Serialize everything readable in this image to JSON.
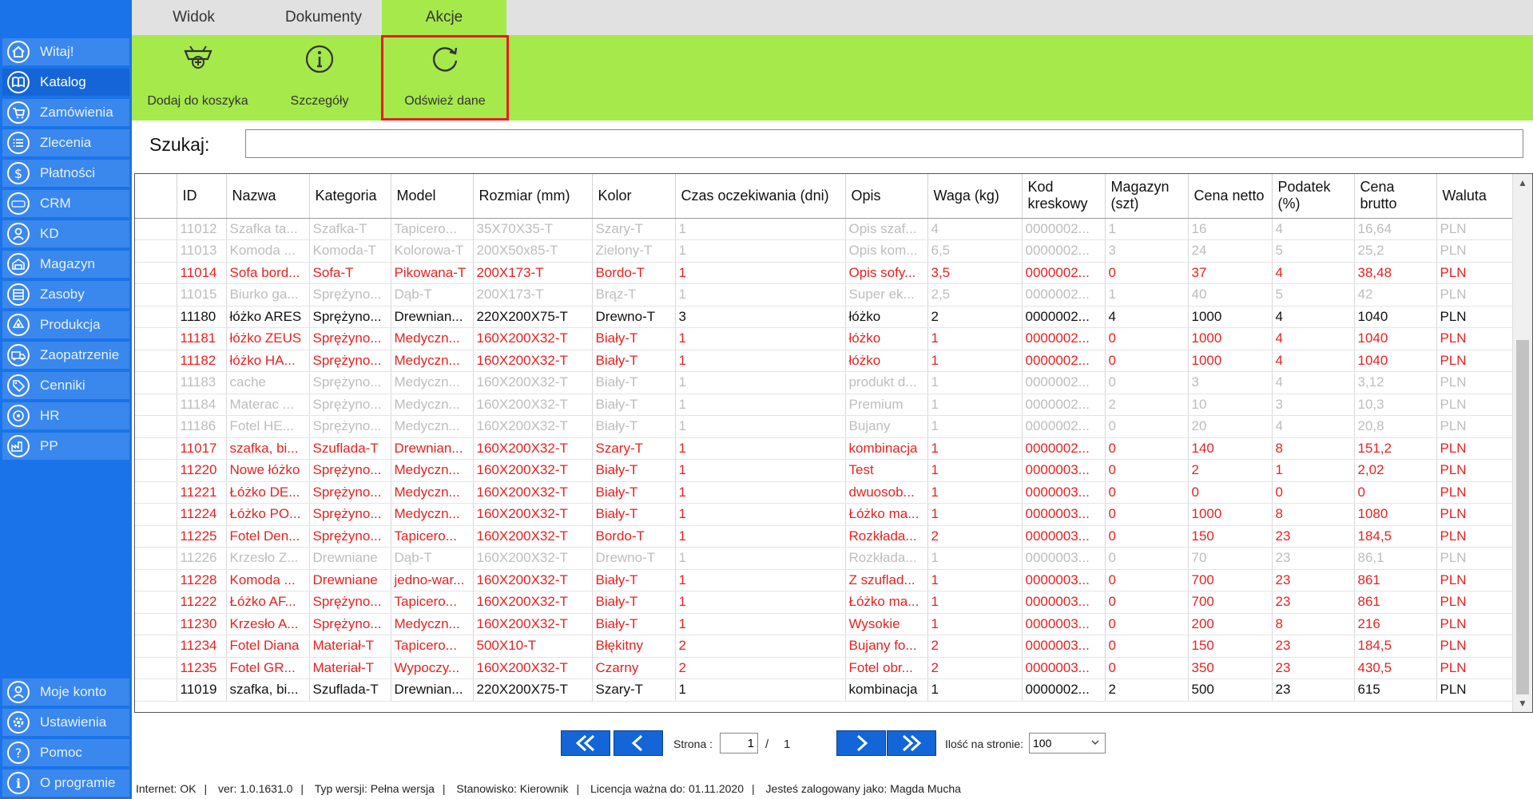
{
  "sidebar": {
    "items": [
      {
        "label": "Witaj!",
        "icon": "home-icon"
      },
      {
        "label": "Katalog",
        "icon": "book-icon",
        "active": true
      },
      {
        "label": "Zamówienia",
        "icon": "cart-icon"
      },
      {
        "label": "Zlecenia",
        "icon": "list-icon"
      },
      {
        "label": "Płatności",
        "icon": "dollar-icon"
      },
      {
        "label": "CRM",
        "icon": "crm-icon"
      },
      {
        "label": "KD",
        "icon": "user-icon"
      },
      {
        "label": "Magazyn",
        "icon": "warehouse-icon"
      },
      {
        "label": "Zasoby",
        "icon": "resources-icon"
      },
      {
        "label": "Produkcja",
        "icon": "production-icon"
      },
      {
        "label": "Zaopatrzenie",
        "icon": "truck-icon"
      },
      {
        "label": "Cenniki",
        "icon": "tag-icon"
      },
      {
        "label": "HR",
        "icon": "hr-icon"
      },
      {
        "label": "PP",
        "icon": "factory-icon"
      }
    ],
    "bottom_items": [
      {
        "label": "Moje konto",
        "icon": "account-icon"
      },
      {
        "label": "Ustawienia",
        "icon": "settings-icon"
      },
      {
        "label": "Pomoc",
        "icon": "help-icon"
      },
      {
        "label": "O programie",
        "icon": "info-icon"
      }
    ]
  },
  "tabs": [
    {
      "label": "Widok"
    },
    {
      "label": "Dokumenty"
    },
    {
      "label": "Akcje",
      "active": true
    }
  ],
  "ribbon": {
    "buttons": [
      {
        "label": "Dodaj do koszyka",
        "icon": "add-to-cart-icon"
      },
      {
        "label": "Szczegóły",
        "icon": "info-circle-icon"
      },
      {
        "label": "Odśwież dane",
        "icon": "refresh-icon",
        "highlighted": true
      }
    ]
  },
  "search": {
    "label": "Szukaj:",
    "value": ""
  },
  "table": {
    "columns": [
      "",
      "ID",
      "Nazwa",
      "Kategoria",
      "Model",
      "Rozmiar (mm)",
      "Kolor",
      "Czas oczekiwania (dni)",
      "Opis",
      "Waga (kg)",
      "Kod kreskowy",
      "Magazyn (szt)",
      "Cena netto",
      "Podatek (%)",
      "Cena brutto",
      "Waluta"
    ],
    "rows": [
      {
        "state": "disabled",
        "cells": [
          "",
          "11012",
          "Szafka ta...",
          "Szafka-T",
          "Tapicero...",
          "35X70X35-T",
          "Szary-T",
          "1",
          "Opis szaf...",
          "4",
          "0000002...",
          "1",
          "16",
          "4",
          "16,64",
          "PLN"
        ]
      },
      {
        "state": "disabled",
        "cells": [
          "",
          "11013",
          "Komoda ...",
          "Komoda-T",
          "Kolorowa-T",
          "200X50x85-T",
          "Zielony-T",
          "1",
          "Opis kom...",
          "6,5",
          "0000002...",
          "3",
          "24",
          "5",
          "25,2",
          "PLN"
        ]
      },
      {
        "state": "error",
        "cells": [
          "",
          "11014",
          "Sofa bord...",
          "Sofa-T",
          "Pikowana-T",
          "200X173-T",
          "Bordo-T",
          "1",
          "Opis sofy...",
          "3,5",
          "0000002...",
          "0",
          "37",
          "4",
          "38,48",
          "PLN"
        ]
      },
      {
        "state": "disabled",
        "cells": [
          "",
          "11015",
          "Biurko ga...",
          "Sprężyno...",
          "Dąb-T",
          "200X173-T",
          "Brąz-T",
          "1",
          "Super ek...",
          "2,5",
          "0000002...",
          "1",
          "40",
          "5",
          "42",
          "PLN"
        ]
      },
      {
        "state": "normal",
        "cells": [
          "",
          "11180",
          "łóżko ARES",
          "Sprężyno...",
          "Drewnian...",
          "220X200X75-T",
          "Drewno-T",
          "3",
          "łóżko",
          "2",
          "0000002...",
          "4",
          "1000",
          "4",
          "1040",
          "PLN"
        ]
      },
      {
        "state": "error",
        "cells": [
          "",
          "11181",
          "łóżko ZEUS",
          "Sprężyno...",
          "Medyczn...",
          "160X200X32-T",
          "Biały-T",
          "1",
          "łóżko",
          "1",
          "0000002...",
          "0",
          "1000",
          "4",
          "1040",
          "PLN"
        ]
      },
      {
        "state": "error",
        "cells": [
          "",
          "11182",
          "łóżko HA...",
          "Sprężyno...",
          "Medyczn...",
          "160X200X32-T",
          "Biały-T",
          "1",
          "łóżko",
          "1",
          "0000002...",
          "0",
          "1000",
          "4",
          "1040",
          "PLN"
        ]
      },
      {
        "state": "disabled",
        "cells": [
          "",
          "11183",
          "cache",
          "Sprężyno...",
          "Medyczn...",
          "160X200X32-T",
          "Biały-T",
          "1",
          "produkt d...",
          "1",
          "0000002...",
          "0",
          "3",
          "4",
          "3,12",
          "PLN"
        ]
      },
      {
        "state": "disabled",
        "cells": [
          "",
          "11184",
          "Materac ...",
          "Sprężyno...",
          "Medyczn...",
          "160X200X32-T",
          "Biały-T",
          "1",
          "Premium",
          "1",
          "0000002...",
          "2",
          "10",
          "3",
          "10,3",
          "PLN"
        ]
      },
      {
        "state": "disabled",
        "cells": [
          "",
          "11186",
          "Fotel HE...",
          "Sprężyno...",
          "Medyczn...",
          "160X200X32-T",
          "Biały-T",
          "1",
          "Bujany",
          "1",
          "0000002...",
          "0",
          "20",
          "4",
          "20,8",
          "PLN"
        ]
      },
      {
        "state": "error",
        "cells": [
          "",
          "11017",
          "szafka, bi...",
          "Szuflada-T",
          "Drewnian...",
          "160X200X32-T",
          "Szary-T",
          "1",
          "kombinacja",
          "1",
          "0000002...",
          "0",
          "140",
          "8",
          "151,2",
          "PLN"
        ]
      },
      {
        "state": "error",
        "cells": [
          "",
          "11220",
          "Nowe łóżko",
          "Sprężyno...",
          "Medyczn...",
          "160X200X32-T",
          "Biały-T",
          "1",
          "Test",
          "1",
          "0000003...",
          "0",
          "2",
          "1",
          "2,02",
          "PLN"
        ]
      },
      {
        "state": "error",
        "cells": [
          "",
          "11221",
          "Łóżko DE...",
          "Sprężyno...",
          "Medyczn...",
          "160X200X32-T",
          "Biały-T",
          "1",
          "dwuosob...",
          "1",
          "0000003...",
          "0",
          "0",
          "0",
          "0",
          "PLN"
        ]
      },
      {
        "state": "error",
        "cells": [
          "",
          "11224",
          "Łóżko PO...",
          "Sprężyno...",
          "Medyczn...",
          "160X200X32-T",
          "Biały-T",
          "1",
          "Łóżko ma...",
          "1",
          "0000003...",
          "0",
          "1000",
          "8",
          "1080",
          "PLN"
        ]
      },
      {
        "state": "error",
        "cells": [
          "",
          "11225",
          "Fotel Den...",
          "Sprężyno...",
          "Tapicero...",
          "160X200X32-T",
          "Bordo-T",
          "1",
          "Rozkłada...",
          "2",
          "0000003...",
          "0",
          "150",
          "23",
          "184,5",
          "PLN"
        ]
      },
      {
        "state": "disabled",
        "cells": [
          "",
          "11226",
          "Krzesło Z...",
          "Drewniane",
          "Dąb-T",
          "160X200X32-T",
          "Drewno-T",
          "1",
          "Rozkłada...",
          "1",
          "0000003...",
          "0",
          "70",
          "23",
          "86,1",
          "PLN"
        ]
      },
      {
        "state": "error",
        "cells": [
          "",
          "11228",
          "Komoda ...",
          "Drewniane",
          "jedno-war...",
          "160X200X32-T",
          "Biały-T",
          "1",
          "Z szuflad...",
          "1",
          "0000003...",
          "0",
          "700",
          "23",
          "861",
          "PLN"
        ]
      },
      {
        "state": "error",
        "cells": [
          "",
          "11222",
          "Łóżko AF...",
          "Sprężyno...",
          "Tapicero...",
          "160X200X32-T",
          "Biały-T",
          "1",
          "Łóżko ma...",
          "1",
          "0000003...",
          "0",
          "700",
          "23",
          "861",
          "PLN"
        ]
      },
      {
        "state": "error",
        "cells": [
          "",
          "11230",
          "Krzesło A...",
          "Sprężyno...",
          "Medyczn...",
          "160X200X32-T",
          "Biały-T",
          "1",
          "Wysokie",
          "1",
          "0000003...",
          "0",
          "200",
          "8",
          "216",
          "PLN"
        ]
      },
      {
        "state": "error",
        "cells": [
          "",
          "11234",
          "Fotel Diana",
          "Materiał-T",
          "Tapicero...",
          "500X10-T",
          "Błękitny",
          "2",
          "Bujany fo...",
          "2",
          "0000003...",
          "0",
          "150",
          "23",
          "184,5",
          "PLN"
        ]
      },
      {
        "state": "error",
        "cells": [
          "",
          "11235",
          "Fotel GR...",
          "Materiał-T",
          "Wypoczy...",
          "160X200X32-T",
          "Czarny",
          "2",
          "Fotel obr...",
          "2",
          "0000003...",
          "0",
          "350",
          "23",
          "430,5",
          "PLN"
        ]
      },
      {
        "state": "normal",
        "cells": [
          "",
          "11019",
          "szafka, bi...",
          "Szuflada-T",
          "Drewnian...",
          "220X200X75-T",
          "Szary-T",
          "1",
          "kombinacja",
          "1",
          "0000002...",
          "2",
          "500",
          "23",
          "615",
          "PLN"
        ]
      }
    ]
  },
  "pagination": {
    "page_label": "Strona :",
    "current_page": "1",
    "separator": "/",
    "total_pages": "1",
    "per_page_label": "Ilość na stronie:",
    "per_page_value": "100"
  },
  "status": {
    "internet": "Internet: OK",
    "version": "ver: 1.0.1631.0",
    "edition": "Typ wersji: Pełna wersja",
    "station": "Stanowisko: Kierownik",
    "license": "Licencja ważna do: 01.11.2020",
    "user": "Jesteś zalogowany jako: Magda Mucha"
  },
  "colors": {
    "sidebar_bg": "#1a73e8",
    "ribbon_green": "#a6e94b",
    "error_text": "#e52222",
    "disabled_text": "#bdbdbd",
    "highlight_border": "#e81c24"
  }
}
